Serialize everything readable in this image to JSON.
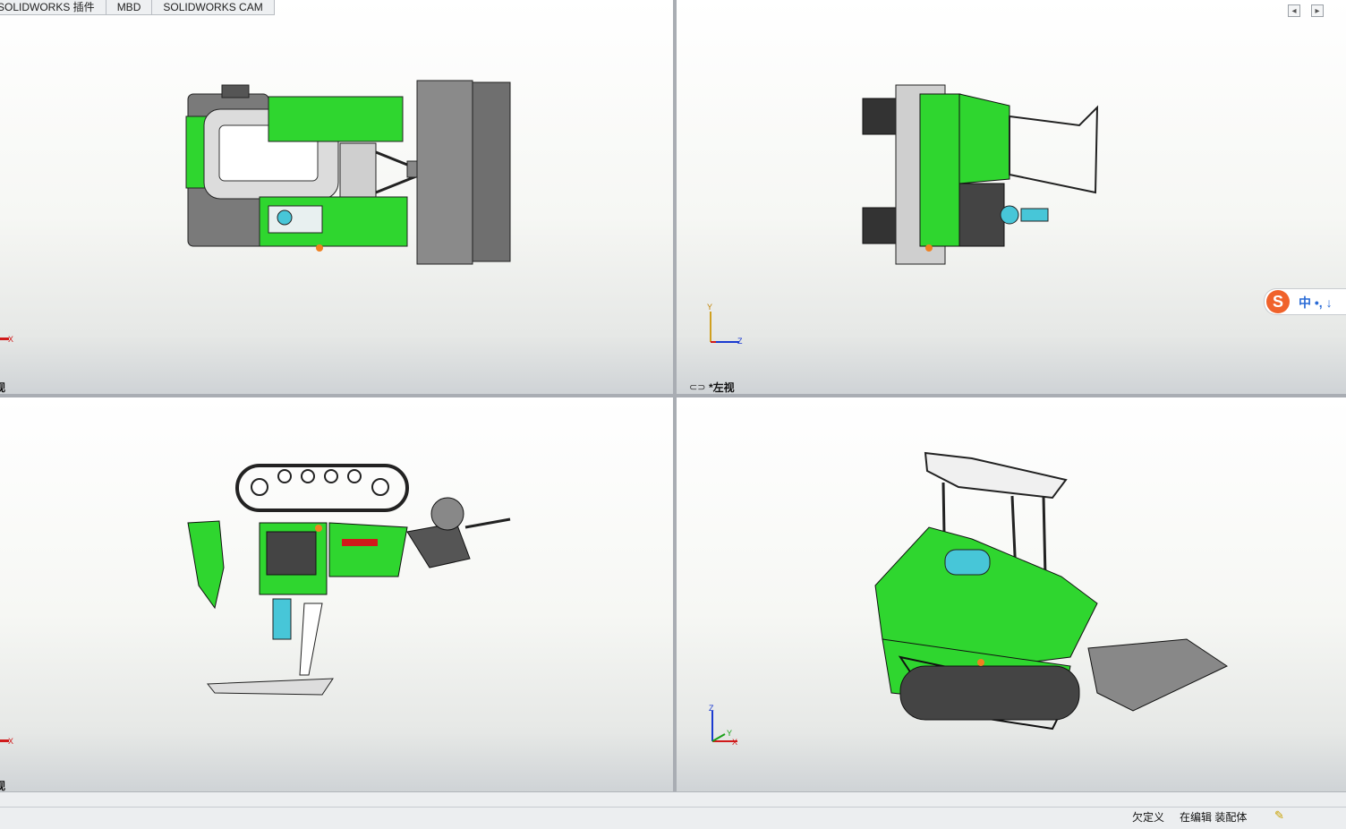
{
  "tabs": [
    "SOLIDWORKS 插件",
    "MBD",
    "SOLIDWORKS CAM"
  ],
  "viewports": {
    "top_left": {
      "label": "视",
      "axis_x": "X"
    },
    "top_right": {
      "label": "*左视",
      "axis_y": "Y",
      "axis_z": "Z"
    },
    "bottom_left": {
      "label": "视",
      "axis_x": "X"
    },
    "bottom_right": {
      "axis_x": "X",
      "axis_y": "Y",
      "axis_z": "Z"
    }
  },
  "ime": {
    "logo": "S",
    "text": "中 •, ↓"
  },
  "hud_icons": [
    "zoom-to-fit-icon",
    "zoom-area-icon",
    "previous-view-icon",
    "section-view-icon",
    "dynamic-annotation-icon",
    "view-orientation-icon",
    "display-style-icon",
    "hide-show-items-icon",
    "edit-appearance-icon",
    "apply-scene-icon",
    "view-settings-icon"
  ],
  "status": {
    "defined": "欠定义",
    "editing": "在编辑 装配体"
  },
  "colors": {
    "machine_green": "#2fd62f",
    "viewport_divider": "#a9adb3",
    "axis_red": "#d01a1a",
    "axis_blue": "#1a3ad0",
    "axis_green": "#18a018"
  }
}
